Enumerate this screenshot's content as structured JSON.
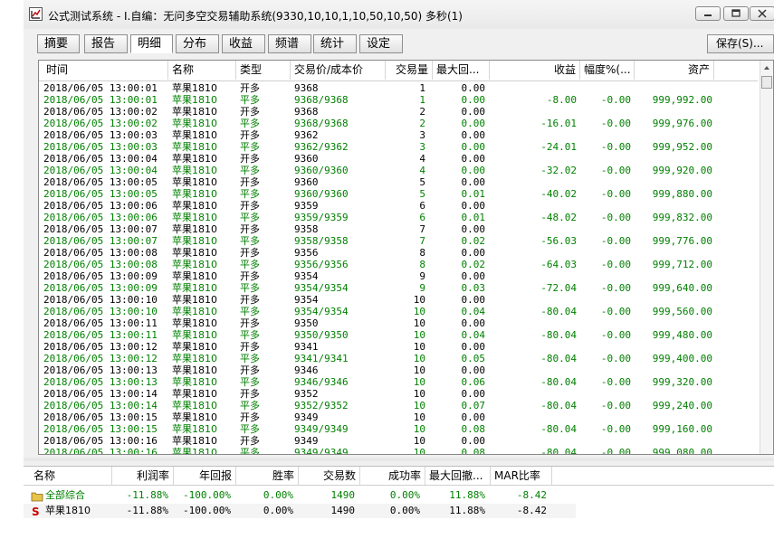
{
  "window": {
    "title": "公式测试系统 - I.自编：无问多空交易辅助系统(9330,10,10,1,10,50,10,50) 多秒(1)"
  },
  "tabs": [
    "摘要",
    "报告",
    "明细",
    "分布",
    "收益",
    "频谱",
    "统计",
    "设定"
  ],
  "active_tab": "明细",
  "save_label": "保存(S)...",
  "colors": {
    "green_row": "#008000",
    "black_row": "#000000",
    "folder_icon": "#e6c34a",
    "s_icon": "#cc0000"
  },
  "detail": {
    "columns": [
      "时间",
      "名称",
      "类型",
      "交易价/成本价",
      "交易量",
      "最大回...",
      "收益",
      "幅度%(...",
      "资产"
    ],
    "rows": [
      {
        "t": "2018/06/05 13:00:01",
        "n": "苹果1810",
        "k": "开多",
        "p": "9368",
        "q": "1",
        "m": "0.00",
        "g": "",
        "f": "",
        "a": "",
        "c": "b"
      },
      {
        "t": "2018/06/05 13:00:01",
        "n": "苹果1810",
        "k": "平多",
        "p": "9368/9368",
        "q": "1",
        "m": "0.00",
        "g": "-8.00",
        "f": "-0.00",
        "a": "999,992.00",
        "c": "g"
      },
      {
        "t": "2018/06/05 13:00:02",
        "n": "苹果1810",
        "k": "开多",
        "p": "9368",
        "q": "2",
        "m": "0.00",
        "g": "",
        "f": "",
        "a": "",
        "c": "b"
      },
      {
        "t": "2018/06/05 13:00:02",
        "n": "苹果1810",
        "k": "平多",
        "p": "9368/9368",
        "q": "2",
        "m": "0.00",
        "g": "-16.01",
        "f": "-0.00",
        "a": "999,976.00",
        "c": "g"
      },
      {
        "t": "2018/06/05 13:00:03",
        "n": "苹果1810",
        "k": "开多",
        "p": "9362",
        "q": "3",
        "m": "0.00",
        "g": "",
        "f": "",
        "a": "",
        "c": "b"
      },
      {
        "t": "2018/06/05 13:00:03",
        "n": "苹果1810",
        "k": "平多",
        "p": "9362/9362",
        "q": "3",
        "m": "0.00",
        "g": "-24.01",
        "f": "-0.00",
        "a": "999,952.00",
        "c": "g"
      },
      {
        "t": "2018/06/05 13:00:04",
        "n": "苹果1810",
        "k": "开多",
        "p": "9360",
        "q": "4",
        "m": "0.00",
        "g": "",
        "f": "",
        "a": "",
        "c": "b"
      },
      {
        "t": "2018/06/05 13:00:04",
        "n": "苹果1810",
        "k": "平多",
        "p": "9360/9360",
        "q": "4",
        "m": "0.00",
        "g": "-32.02",
        "f": "-0.00",
        "a": "999,920.00",
        "c": "g"
      },
      {
        "t": "2018/06/05 13:00:05",
        "n": "苹果1810",
        "k": "开多",
        "p": "9360",
        "q": "5",
        "m": "0.00",
        "g": "",
        "f": "",
        "a": "",
        "c": "b"
      },
      {
        "t": "2018/06/05 13:00:05",
        "n": "苹果1810",
        "k": "平多",
        "p": "9360/9360",
        "q": "5",
        "m": "0.01",
        "g": "-40.02",
        "f": "-0.00",
        "a": "999,880.00",
        "c": "g"
      },
      {
        "t": "2018/06/05 13:00:06",
        "n": "苹果1810",
        "k": "开多",
        "p": "9359",
        "q": "6",
        "m": "0.00",
        "g": "",
        "f": "",
        "a": "",
        "c": "b"
      },
      {
        "t": "2018/06/05 13:00:06",
        "n": "苹果1810",
        "k": "平多",
        "p": "9359/9359",
        "q": "6",
        "m": "0.01",
        "g": "-48.02",
        "f": "-0.00",
        "a": "999,832.00",
        "c": "g"
      },
      {
        "t": "2018/06/05 13:00:07",
        "n": "苹果1810",
        "k": "开多",
        "p": "9358",
        "q": "7",
        "m": "0.00",
        "g": "",
        "f": "",
        "a": "",
        "c": "b"
      },
      {
        "t": "2018/06/05 13:00:07",
        "n": "苹果1810",
        "k": "平多",
        "p": "9358/9358",
        "q": "7",
        "m": "0.02",
        "g": "-56.03",
        "f": "-0.00",
        "a": "999,776.00",
        "c": "g"
      },
      {
        "t": "2018/06/05 13:00:08",
        "n": "苹果1810",
        "k": "开多",
        "p": "9356",
        "q": "8",
        "m": "0.00",
        "g": "",
        "f": "",
        "a": "",
        "c": "b"
      },
      {
        "t": "2018/06/05 13:00:08",
        "n": "苹果1810",
        "k": "平多",
        "p": "9356/9356",
        "q": "8",
        "m": "0.02",
        "g": "-64.03",
        "f": "-0.00",
        "a": "999,712.00",
        "c": "g"
      },
      {
        "t": "2018/06/05 13:00:09",
        "n": "苹果1810",
        "k": "开多",
        "p": "9354",
        "q": "9",
        "m": "0.00",
        "g": "",
        "f": "",
        "a": "",
        "c": "b"
      },
      {
        "t": "2018/06/05 13:00:09",
        "n": "苹果1810",
        "k": "平多",
        "p": "9354/9354",
        "q": "9",
        "m": "0.03",
        "g": "-72.04",
        "f": "-0.00",
        "a": "999,640.00",
        "c": "g"
      },
      {
        "t": "2018/06/05 13:00:10",
        "n": "苹果1810",
        "k": "开多",
        "p": "9354",
        "q": "10",
        "m": "0.00",
        "g": "",
        "f": "",
        "a": "",
        "c": "b"
      },
      {
        "t": "2018/06/05 13:00:10",
        "n": "苹果1810",
        "k": "平多",
        "p": "9354/9354",
        "q": "10",
        "m": "0.04",
        "g": "-80.04",
        "f": "-0.00",
        "a": "999,560.00",
        "c": "g"
      },
      {
        "t": "2018/06/05 13:00:11",
        "n": "苹果1810",
        "k": "开多",
        "p": "9350",
        "q": "10",
        "m": "0.00",
        "g": "",
        "f": "",
        "a": "",
        "c": "b"
      },
      {
        "t": "2018/06/05 13:00:11",
        "n": "苹果1810",
        "k": "平多",
        "p": "9350/9350",
        "q": "10",
        "m": "0.04",
        "g": "-80.04",
        "f": "-0.00",
        "a": "999,480.00",
        "c": "g"
      },
      {
        "t": "2018/06/05 13:00:12",
        "n": "苹果1810",
        "k": "开多",
        "p": "9341",
        "q": "10",
        "m": "0.00",
        "g": "",
        "f": "",
        "a": "",
        "c": "b"
      },
      {
        "t": "2018/06/05 13:00:12",
        "n": "苹果1810",
        "k": "平多",
        "p": "9341/9341",
        "q": "10",
        "m": "0.05",
        "g": "-80.04",
        "f": "-0.00",
        "a": "999,400.00",
        "c": "g"
      },
      {
        "t": "2018/06/05 13:00:13",
        "n": "苹果1810",
        "k": "开多",
        "p": "9346",
        "q": "10",
        "m": "0.00",
        "g": "",
        "f": "",
        "a": "",
        "c": "b"
      },
      {
        "t": "2018/06/05 13:00:13",
        "n": "苹果1810",
        "k": "平多",
        "p": "9346/9346",
        "q": "10",
        "m": "0.06",
        "g": "-80.04",
        "f": "-0.00",
        "a": "999,320.00",
        "c": "g"
      },
      {
        "t": "2018/06/05 13:00:14",
        "n": "苹果1810",
        "k": "开多",
        "p": "9352",
        "q": "10",
        "m": "0.00",
        "g": "",
        "f": "",
        "a": "",
        "c": "b"
      },
      {
        "t": "2018/06/05 13:00:14",
        "n": "苹果1810",
        "k": "平多",
        "p": "9352/9352",
        "q": "10",
        "m": "0.07",
        "g": "-80.04",
        "f": "-0.00",
        "a": "999,240.00",
        "c": "g"
      },
      {
        "t": "2018/06/05 13:00:15",
        "n": "苹果1810",
        "k": "开多",
        "p": "9349",
        "q": "10",
        "m": "0.00",
        "g": "",
        "f": "",
        "a": "",
        "c": "b"
      },
      {
        "t": "2018/06/05 13:00:15",
        "n": "苹果1810",
        "k": "平多",
        "p": "9349/9349",
        "q": "10",
        "m": "0.08",
        "g": "-80.04",
        "f": "-0.00",
        "a": "999,160.00",
        "c": "g"
      },
      {
        "t": "2018/06/05 13:00:16",
        "n": "苹果1810",
        "k": "开多",
        "p": "9349",
        "q": "10",
        "m": "0.00",
        "g": "",
        "f": "",
        "a": "",
        "c": "b"
      },
      {
        "t": "2018/06/05 13:00:16",
        "n": "苹果1810",
        "k": "平多",
        "p": "9349/9349",
        "q": "10",
        "m": "0.08",
        "g": "-80.04",
        "f": "-0.00",
        "a": "999,080.00",
        "c": "g"
      }
    ]
  },
  "summary": {
    "columns": [
      "名称",
      "利润率",
      "年回报",
      "胜率",
      "交易数",
      "成功率",
      "最大回撤...",
      "MAR比率"
    ],
    "rows": [
      {
        "icon": "folder-icon",
        "name": "全部综合",
        "profit": "-11.88%",
        "annual": "-100.00%",
        "win": "0.00%",
        "trades": "1490",
        "success": "0.00%",
        "dd": "11.88%",
        "mar": "-8.42",
        "c": "g"
      },
      {
        "icon": "s-icon",
        "name": "苹果1810",
        "profit": "-11.88%",
        "annual": "-100.00%",
        "win": "0.00%",
        "trades": "1490",
        "success": "0.00%",
        "dd": "11.88%",
        "mar": "-8.42",
        "c": "b"
      }
    ]
  }
}
